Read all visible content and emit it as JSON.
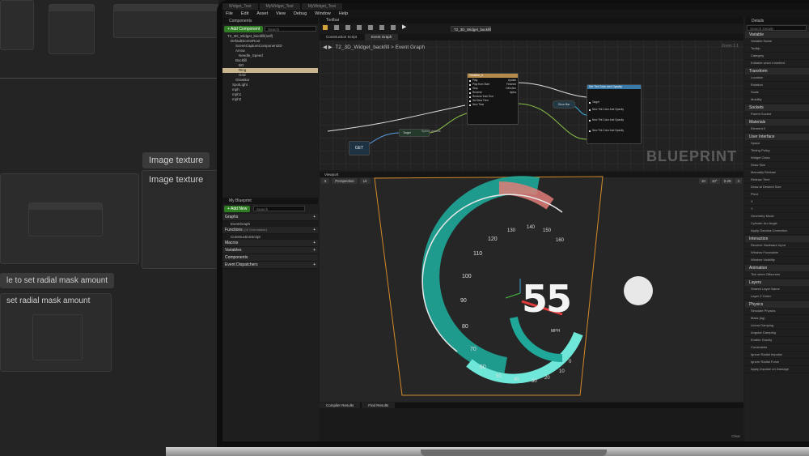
{
  "background_workspace": {
    "image_texture_label_1": "Image texture",
    "image_texture_label_2": "Image texture",
    "radial_mask_button_1": "le to set radial mask amount",
    "radial_mask_button_2": "set radial mask amount"
  },
  "window": {
    "tabs": [
      "Widget_Test",
      "MyWidget_Test",
      "MyWidget_Test"
    ],
    "menu": [
      "File",
      "Edit",
      "Asset",
      "View",
      "Debug",
      "Window",
      "Help"
    ]
  },
  "components": {
    "title": "Components",
    "add_button": "+ Add Component",
    "search_placeholder": "Search",
    "root_label": "T2_3D_Widget_backfill(self)",
    "tree": [
      "DefaultSceneRoot",
      "SceneCaptureComponent2D",
      "Arrow",
      "Needle_Speed",
      "Backfill",
      "BG",
      "Ring",
      "Grid",
      "GlowBar",
      "SpotLight",
      "mph",
      "mph1",
      "mph2"
    ],
    "selected_index": 6
  },
  "my_blueprint": {
    "title": "My Blueprint",
    "add_button": "+ Add New",
    "search_placeholder": "Search",
    "sections": [
      {
        "label": "Graphs",
        "items": [
          "EventGraph"
        ]
      },
      {
        "label": "Functions",
        "note": "(26 Overridable)",
        "items": [
          "ConstructionScript"
        ]
      },
      {
        "label": "Macros",
        "items": []
      },
      {
        "label": "Variables",
        "items": []
      },
      {
        "label": "Components",
        "items": []
      },
      {
        "label": "Event Dispatchers",
        "items": []
      }
    ]
  },
  "toolbar": {
    "title": "Toolbar",
    "dropdown": "T2_3D_Widget_backfill"
  },
  "graph": {
    "tabs": [
      "Construction Script",
      "Event Graph"
    ],
    "breadcrumb": [
      "T2_3D_Widget_backfill",
      "Event Graph"
    ],
    "zoom": "Zoom 1:1",
    "watermark": "BLUEPRINT",
    "timeline_node": {
      "title": "Timeline_0",
      "inputs": [
        "Play",
        "Play from Start",
        "Stop",
        "Reverse",
        "Reverse from End",
        "Set New Time",
        "New Time"
      ],
      "outputs": [
        "Update",
        "Finished",
        "Direction",
        "Alpha"
      ]
    },
    "set_tint_node": {
      "title": "Set Tint Color and Opacity",
      "pins": [
        "Target",
        "New Tint Color And Opacity",
        "New Tint Color And Opacity",
        "New Tint Color And Opacity"
      ]
    },
    "get_node": "GET",
    "target_node": "Target",
    "glow_bar_node": "Glow Bar",
    "speed_variable": "Speed Variable"
  },
  "viewport": {
    "title": "Viewport",
    "view_mode": "Perspective",
    "lit_mode": "Lit",
    "speed_value": "55",
    "unit": "MPH",
    "gauge_ticks": [
      "0",
      "10",
      "20",
      "30",
      "40",
      "50",
      "60",
      "70",
      "80",
      "90",
      "100",
      "110",
      "120",
      "130",
      "140",
      "150",
      "160"
    ],
    "grid_snap": "10",
    "rotation_snap": "10°",
    "scale_snap": "0.25",
    "camera_speed": "4",
    "colors": {
      "ring": "#1fa89a",
      "ring_glow": "#6ee6d8",
      "warning_arc": "#e07d78",
      "needle": "#e33b3b",
      "frame": "#d4892a"
    }
  },
  "results": {
    "tabs": [
      "Compiler Results",
      "Find Results"
    ],
    "clear": "Clear"
  },
  "details": {
    "title": "Details",
    "search_placeholder": "Search Details",
    "sections": [
      {
        "label": "Variable",
        "rows": [
          "Variable Name",
          "Tooltip",
          "Category",
          "Editable when Inherited"
        ]
      },
      {
        "label": "Transform",
        "rows": [
          "Location",
          "Rotation",
          "Scale",
          "Mobility"
        ]
      },
      {
        "label": "Sockets",
        "rows": [
          "Parent Socket"
        ]
      },
      {
        "label": "Materials",
        "rows": [
          "Element 0"
        ]
      },
      {
        "label": "User Interface",
        "rows": [
          "Space",
          "Timing Policy",
          "Widget Class",
          "Draw Size",
          "Manually Redraw",
          "Redraw Time",
          "Draw at Desired Size",
          "Pivot",
          "X",
          "Y",
          "Geometry Mode",
          "Cylinder Arc Angle",
          "Apply Gamma Correction"
        ]
      },
      {
        "label": "Interaction",
        "rows": [
          "Receive Hardware Input",
          "Window Focusable",
          "Window Visibility"
        ]
      },
      {
        "label": "Animation",
        "rows": [
          "Tick when Offscreen"
        ]
      },
      {
        "label": "Layers",
        "rows": [
          "Shared Layer Name",
          "Layer Z Order"
        ]
      },
      {
        "label": "Physics",
        "rows": [
          "Simulate Physics",
          "Mass (kg)",
          "Linear Damping",
          "Angular Damping",
          "Enable Gravity",
          "Constraints",
          "Ignore Radial Impulse",
          "Ignore Radial Force",
          "Apply Impulse on Damage"
        ]
      }
    ]
  }
}
